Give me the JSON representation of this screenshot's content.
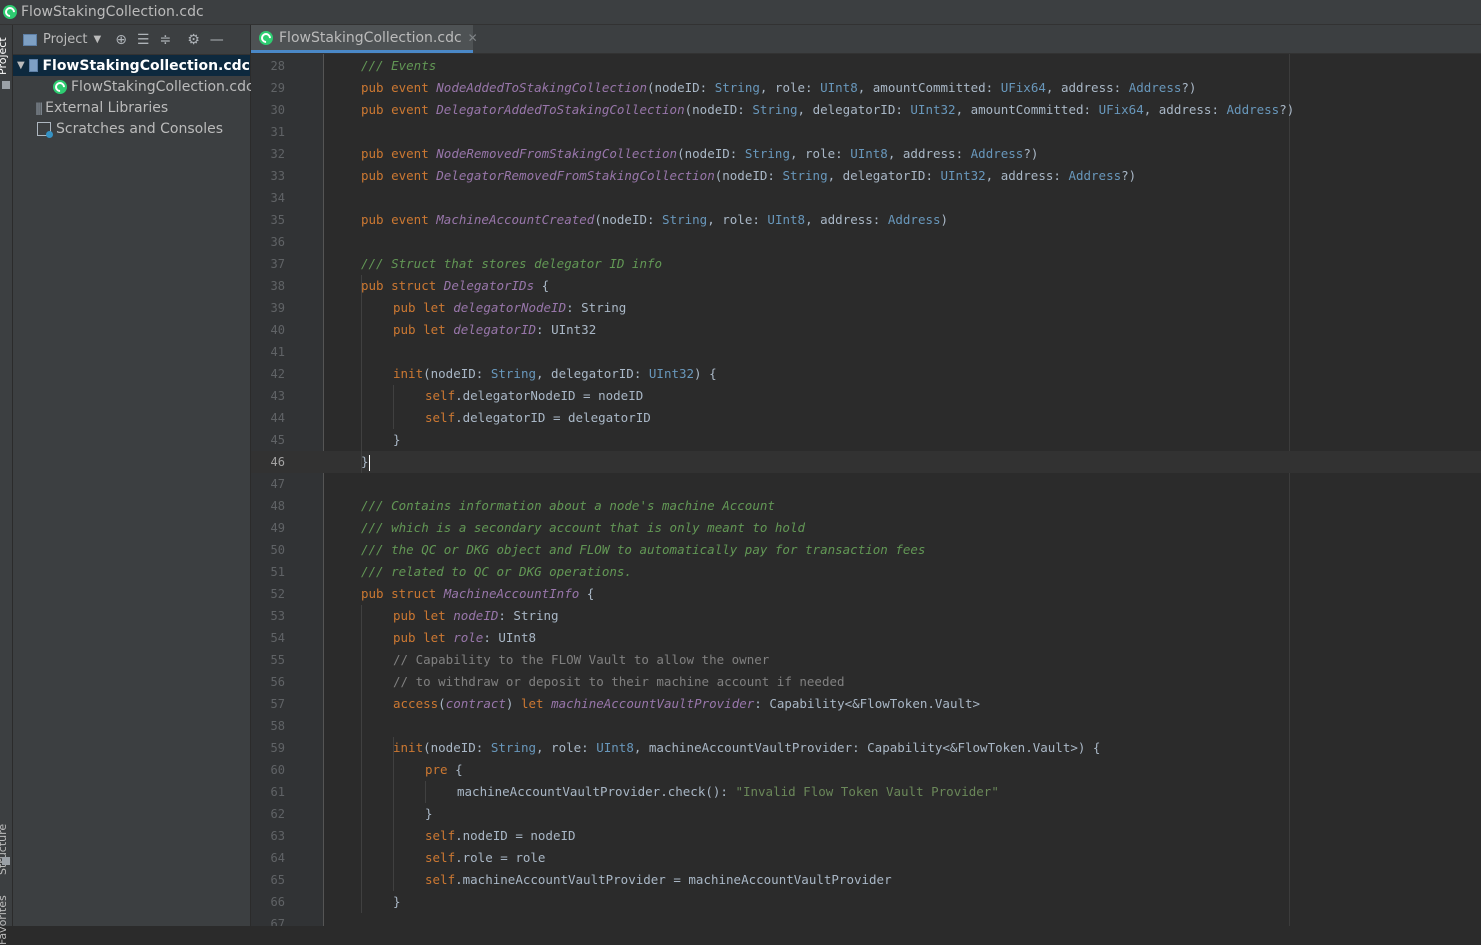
{
  "window": {
    "title": "FlowStakingCollection.cdc"
  },
  "toolstrip": {
    "project": "Project",
    "structure": "Structure",
    "favorites": "Favorites"
  },
  "project_panel": {
    "title": "Project",
    "tree": [
      {
        "label": "FlowStakingCollection.cdc",
        "icon": "folder-icon",
        "selected": true,
        "expanded": true,
        "depth": 0
      },
      {
        "label": "FlowStakingCollection.cdc",
        "icon": "flow-file-icon",
        "depth": 1
      },
      {
        "label": "External Libraries",
        "icon": "library-icon",
        "depth": 0
      },
      {
        "label": "Scratches and Consoles",
        "icon": "scratch-icon",
        "depth": 0
      }
    ]
  },
  "editor": {
    "tabs": [
      {
        "label": "FlowStakingCollection.cdc",
        "active": true
      }
    ],
    "current_line": 46,
    "lines": [
      {
        "n": "28",
        "indent": 1,
        "tokens": [
          [
            "comment",
            "/// Events"
          ]
        ]
      },
      {
        "n": "29",
        "indent": 1,
        "tokens": [
          [
            "keyword",
            "pub event "
          ],
          [
            "ident",
            "NodeAddedToStakingCollection"
          ],
          [
            "plain",
            "(nodeID: "
          ],
          [
            "type",
            "String"
          ],
          [
            "plain",
            ", role: "
          ],
          [
            "type",
            "UInt8"
          ],
          [
            "plain",
            ", amountCommitted: "
          ],
          [
            "type",
            "UFix64"
          ],
          [
            "plain",
            ", address: "
          ],
          [
            "type",
            "Address"
          ],
          [
            "plain",
            "?)"
          ]
        ]
      },
      {
        "n": "30",
        "indent": 1,
        "tokens": [
          [
            "keyword",
            "pub event "
          ],
          [
            "ident",
            "DelegatorAddedToStakingCollection"
          ],
          [
            "plain",
            "(nodeID: "
          ],
          [
            "type",
            "String"
          ],
          [
            "plain",
            ", delegatorID: "
          ],
          [
            "type",
            "UInt32"
          ],
          [
            "plain",
            ", amountCommitted: "
          ],
          [
            "type",
            "UFix64"
          ],
          [
            "plain",
            ", address: "
          ],
          [
            "type",
            "Address"
          ],
          [
            "plain",
            "?)"
          ]
        ]
      },
      {
        "n": "31",
        "indent": 0,
        "tokens": []
      },
      {
        "n": "32",
        "indent": 1,
        "tokens": [
          [
            "keyword",
            "pub event "
          ],
          [
            "ident",
            "NodeRemovedFromStakingCollection"
          ],
          [
            "plain",
            "(nodeID: "
          ],
          [
            "type",
            "String"
          ],
          [
            "plain",
            ", role: "
          ],
          [
            "type",
            "UInt8"
          ],
          [
            "plain",
            ", address: "
          ],
          [
            "type",
            "Address"
          ],
          [
            "plain",
            "?)"
          ]
        ]
      },
      {
        "n": "33",
        "indent": 1,
        "tokens": [
          [
            "keyword",
            "pub event "
          ],
          [
            "ident",
            "DelegatorRemovedFromStakingCollection"
          ],
          [
            "plain",
            "(nodeID: "
          ],
          [
            "type",
            "String"
          ],
          [
            "plain",
            ", delegatorID: "
          ],
          [
            "type",
            "UInt32"
          ],
          [
            "plain",
            ", address: "
          ],
          [
            "type",
            "Address"
          ],
          [
            "plain",
            "?)"
          ]
        ]
      },
      {
        "n": "34",
        "indent": 0,
        "tokens": []
      },
      {
        "n": "35",
        "indent": 1,
        "tokens": [
          [
            "keyword",
            "pub event "
          ],
          [
            "ident",
            "MachineAccountCreated"
          ],
          [
            "plain",
            "(nodeID: "
          ],
          [
            "type",
            "String"
          ],
          [
            "plain",
            ", role: "
          ],
          [
            "type",
            "UInt8"
          ],
          [
            "plain",
            ", address: "
          ],
          [
            "type",
            "Address"
          ],
          [
            "plain",
            ")"
          ]
        ]
      },
      {
        "n": "36",
        "indent": 0,
        "tokens": []
      },
      {
        "n": "37",
        "indent": 1,
        "tokens": [
          [
            "comment",
            "/// Struct that stores delegator ID info"
          ]
        ]
      },
      {
        "n": "38",
        "indent": 1,
        "tokens": [
          [
            "keyword",
            "pub struct "
          ],
          [
            "ident",
            "DelegatorIDs"
          ],
          [
            "plain",
            " {"
          ]
        ]
      },
      {
        "n": "39",
        "indent": 2,
        "tokens": [
          [
            "keyword",
            "pub let "
          ],
          [
            "ident",
            "delegatorNodeID"
          ],
          [
            "plain",
            ": String"
          ]
        ]
      },
      {
        "n": "40",
        "indent": 2,
        "tokens": [
          [
            "keyword",
            "pub let "
          ],
          [
            "ident",
            "delegatorID"
          ],
          [
            "plain",
            ": UInt32"
          ]
        ]
      },
      {
        "n": "41",
        "indent": 0,
        "tokens": []
      },
      {
        "n": "42",
        "indent": 2,
        "tokens": [
          [
            "keyword",
            "init"
          ],
          [
            "plain",
            "(nodeID: "
          ],
          [
            "type",
            "String"
          ],
          [
            "plain",
            ", delegatorID: "
          ],
          [
            "type",
            "UInt32"
          ],
          [
            "plain",
            ") {"
          ]
        ]
      },
      {
        "n": "43",
        "indent": 3,
        "tokens": [
          [
            "self",
            "self"
          ],
          [
            "plain",
            ".delegatorNodeID = nodeID"
          ]
        ]
      },
      {
        "n": "44",
        "indent": 3,
        "tokens": [
          [
            "self",
            "self"
          ],
          [
            "plain",
            ".delegatorID = delegatorID"
          ]
        ]
      },
      {
        "n": "45",
        "indent": 2,
        "tokens": [
          [
            "plain",
            "}"
          ]
        ]
      },
      {
        "n": "46",
        "indent": 1,
        "tokens": [
          [
            "plain",
            "}"
          ]
        ],
        "caret": true
      },
      {
        "n": "47",
        "indent": 0,
        "tokens": []
      },
      {
        "n": "48",
        "indent": 1,
        "tokens": [
          [
            "comment",
            "/// Contains information about a node's machine Account"
          ]
        ]
      },
      {
        "n": "49",
        "indent": 1,
        "tokens": [
          [
            "comment",
            "/// which is a secondary account that is only meant to hold"
          ]
        ]
      },
      {
        "n": "50",
        "indent": 1,
        "tokens": [
          [
            "comment",
            "/// the QC or DKG object and FLOW to automatically pay for transaction fees"
          ]
        ]
      },
      {
        "n": "51",
        "indent": 1,
        "tokens": [
          [
            "comment",
            "/// related to QC or DKG operations."
          ]
        ]
      },
      {
        "n": "52",
        "indent": 1,
        "tokens": [
          [
            "keyword",
            "pub struct "
          ],
          [
            "ident",
            "MachineAccountInfo"
          ],
          [
            "plain",
            " {"
          ]
        ]
      },
      {
        "n": "53",
        "indent": 2,
        "tokens": [
          [
            "keyword",
            "pub let "
          ],
          [
            "ident",
            "nodeID"
          ],
          [
            "plain",
            ": String"
          ]
        ]
      },
      {
        "n": "54",
        "indent": 2,
        "tokens": [
          [
            "keyword",
            "pub let "
          ],
          [
            "ident",
            "role"
          ],
          [
            "plain",
            ": UInt8"
          ]
        ]
      },
      {
        "n": "55",
        "indent": 2,
        "tokens": [
          [
            "comment2",
            "// Capability to the FLOW Vault to allow the owner"
          ]
        ]
      },
      {
        "n": "56",
        "indent": 2,
        "tokens": [
          [
            "comment2",
            "// to withdraw or deposit to their machine account if needed"
          ]
        ]
      },
      {
        "n": "57",
        "indent": 2,
        "tokens": [
          [
            "keyword",
            "access"
          ],
          [
            "plain",
            "("
          ],
          [
            "ident",
            "contract"
          ],
          [
            "plain",
            ") "
          ],
          [
            "keyword",
            "let "
          ],
          [
            "ident",
            "machineAccountVaultProvider"
          ],
          [
            "plain",
            ": Capability<&FlowToken.Vault>"
          ]
        ]
      },
      {
        "n": "58",
        "indent": 0,
        "tokens": []
      },
      {
        "n": "59",
        "indent": 2,
        "tokens": [
          [
            "keyword",
            "init"
          ],
          [
            "plain",
            "(nodeID: "
          ],
          [
            "type",
            "String"
          ],
          [
            "plain",
            ", role: "
          ],
          [
            "type",
            "UInt8"
          ],
          [
            "plain",
            ", machineAccountVaultProvider: Capability<&FlowToken.Vault>) {"
          ]
        ]
      },
      {
        "n": "60",
        "indent": 3,
        "tokens": [
          [
            "keyword",
            "pre"
          ],
          [
            "plain",
            " {"
          ]
        ]
      },
      {
        "n": "61",
        "indent": 4,
        "tokens": [
          [
            "plain",
            "machineAccountVaultProvider.check(): "
          ],
          [
            "string",
            "\"Invalid Flow Token Vault Provider\""
          ]
        ]
      },
      {
        "n": "62",
        "indent": 3,
        "tokens": [
          [
            "plain",
            "}"
          ]
        ]
      },
      {
        "n": "63",
        "indent": 3,
        "tokens": [
          [
            "self",
            "self"
          ],
          [
            "plain",
            ".nodeID = nodeID"
          ]
        ]
      },
      {
        "n": "64",
        "indent": 3,
        "tokens": [
          [
            "self",
            "self"
          ],
          [
            "plain",
            ".role = role"
          ]
        ]
      },
      {
        "n": "65",
        "indent": 3,
        "tokens": [
          [
            "self",
            "self"
          ],
          [
            "plain",
            ".machineAccountVaultProvider = machineAccountVaultProvider"
          ]
        ]
      },
      {
        "n": "66",
        "indent": 2,
        "tokens": [
          [
            "plain",
            "}"
          ]
        ]
      },
      {
        "n": "67",
        "indent": 0,
        "tokens": []
      }
    ]
  }
}
